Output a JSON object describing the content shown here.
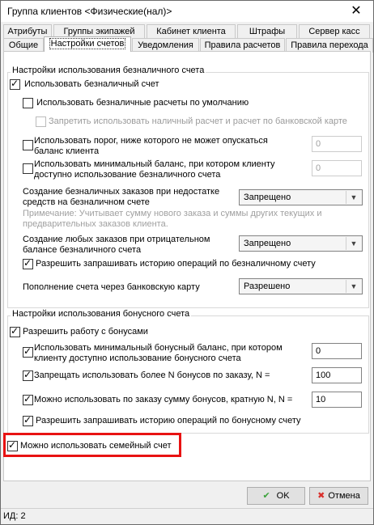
{
  "window": {
    "title": "Группа клиентов <Физические(нал)>"
  },
  "tabs_row1": [
    "Атрибуты",
    "Группы экипажей",
    "Кабинет клиента",
    "Штрафы",
    "Сервер касс"
  ],
  "tabs_row2": [
    "Общие",
    "Настройки счетов",
    "Уведомления",
    "Правила расчетов",
    "Правила перехода"
  ],
  "cashless": {
    "group_title": "Настройки использования безналичного счета",
    "use_cashless": "Использовать безналичный счет",
    "use_cashless_default": "Использовать безналичные расчеты по умолчанию",
    "forbid_cash": "Запретить использовать наличный расчет и расчет по банковской карте",
    "threshold_line1": "Использовать порог, ниже которого не может опускаться",
    "threshold_line2": "баланс клиента",
    "threshold_value": "0",
    "min_balance_line1": "Использовать минимальный баланс, при котором клиенту",
    "min_balance_line2": "доступно использование безналичного счета",
    "min_balance_value": "0",
    "create_orders_line1": "Создание безналичных заказов при недостатке",
    "create_orders_line2": "средств на безналичном счете",
    "create_orders_value": "Запрещено",
    "note_line1": "Примечание: Учитывает сумму нового заказа и суммы других текущих и",
    "note_line2": "предварительных заказов клиента.",
    "any_orders_line1": "Создание любых заказов при отрицательном",
    "any_orders_line2": "балансе безналичного счета",
    "any_orders_value": "Запрещено",
    "allow_history": "Разрешить запрашивать историю операций по безналичному счету",
    "topup_label": "Пополнение счета через банковскую карту",
    "topup_value": "Разрешено"
  },
  "bonus": {
    "group_title": "Настройки использования бонусного счета",
    "allow_bonus": "Разрешить работу с бонусами",
    "min_bonus_line1": "Использовать минимальный бонусный баланс, при котором",
    "min_bonus_line2": "клиенту доступно использование бонусного счета",
    "min_bonus_value": "0",
    "forbid_more_n": "Запрещать использовать более N бонусов по заказу, N =",
    "forbid_more_n_value": "100",
    "multiple_n": "Можно использовать по заказу сумму бонусов, кратную N, N =",
    "multiple_n_value": "10",
    "allow_bonus_history": "Разрешить запрашивать историю операций по бонусному счету"
  },
  "family": {
    "label": "Можно использовать семейный счет"
  },
  "buttons": {
    "ok": "OK",
    "cancel": "Отмена"
  },
  "status": {
    "text": "ИД: 2"
  },
  "colors": {
    "highlight": "#e81212",
    "ok_icon": "#3aa23a",
    "cancel_icon": "#d9302c"
  }
}
